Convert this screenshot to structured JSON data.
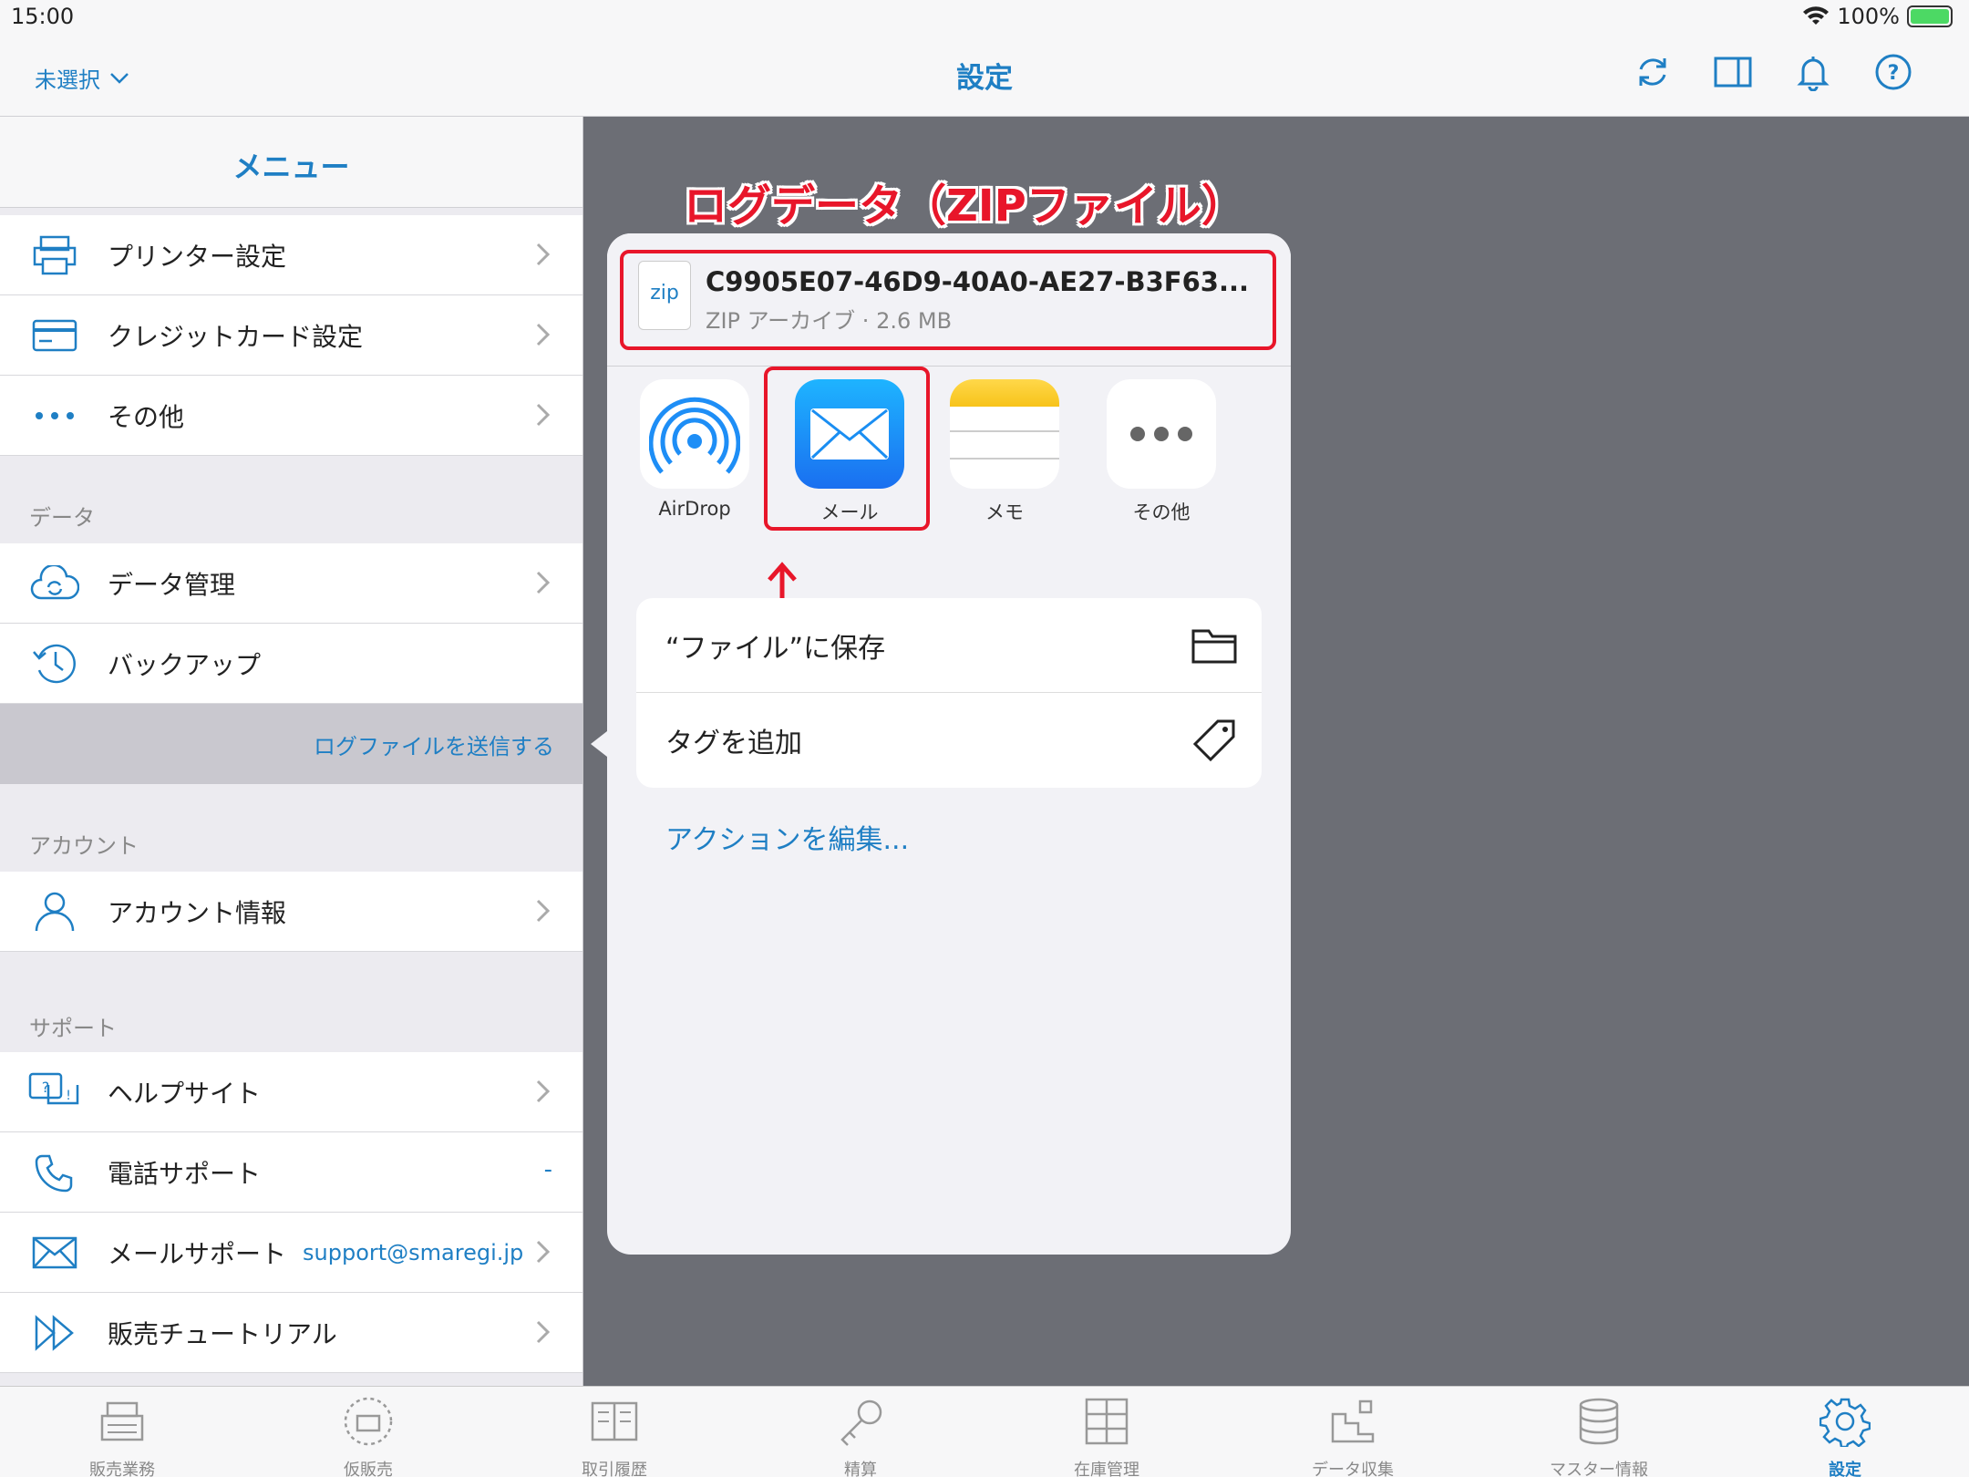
{
  "status": {
    "time": "15:00",
    "battery": "100%"
  },
  "nav": {
    "left_label": "未選択",
    "title": "設定"
  },
  "sidebar": {
    "header": "メニュー",
    "items": [
      {
        "label": "プリンター設定"
      },
      {
        "label": "クレジットカード設定"
      },
      {
        "label": "その他"
      },
      {
        "label": "データ管理"
      },
      {
        "label": "バックアップ"
      },
      {
        "label": "アカウント情報"
      },
      {
        "label": "ヘルプサイト"
      },
      {
        "label": "電話サポート",
        "value": "-"
      },
      {
        "label": "メールサポート",
        "value": "support@smaregi.jp"
      },
      {
        "label": "販売チュートリアル"
      }
    ],
    "sections": {
      "data": "データ",
      "account": "アカウント",
      "support": "サポート"
    },
    "send_log": "ログファイルを送信する"
  },
  "annotation": {
    "title": "ログデータ（ZIPファイル）"
  },
  "share": {
    "file_icon": "zip",
    "file_name": "C9905E07-46D9-40A0-AE27-B3F63...",
    "file_meta": "ZIP アーカイブ · 2.6 MB",
    "apps": [
      {
        "label": "AirDrop"
      },
      {
        "label": "メール"
      },
      {
        "label": "メモ"
      },
      {
        "label": "その他"
      }
    ],
    "actions": [
      {
        "label": "“ファイル”に保存"
      },
      {
        "label": "タグを追加"
      }
    ],
    "edit_actions": "アクションを編集..."
  },
  "tabs": [
    {
      "label": "販売業務"
    },
    {
      "label": "仮販売"
    },
    {
      "label": "取引履歴"
    },
    {
      "label": "精算"
    },
    {
      "label": "在庫管理"
    },
    {
      "label": "データ収集"
    },
    {
      "label": "マスター情報"
    },
    {
      "label": "設定"
    }
  ],
  "colors": {
    "accent": "#1f7fc4",
    "annotation": "#e8162a",
    "backdrop": "#6c6e75"
  }
}
